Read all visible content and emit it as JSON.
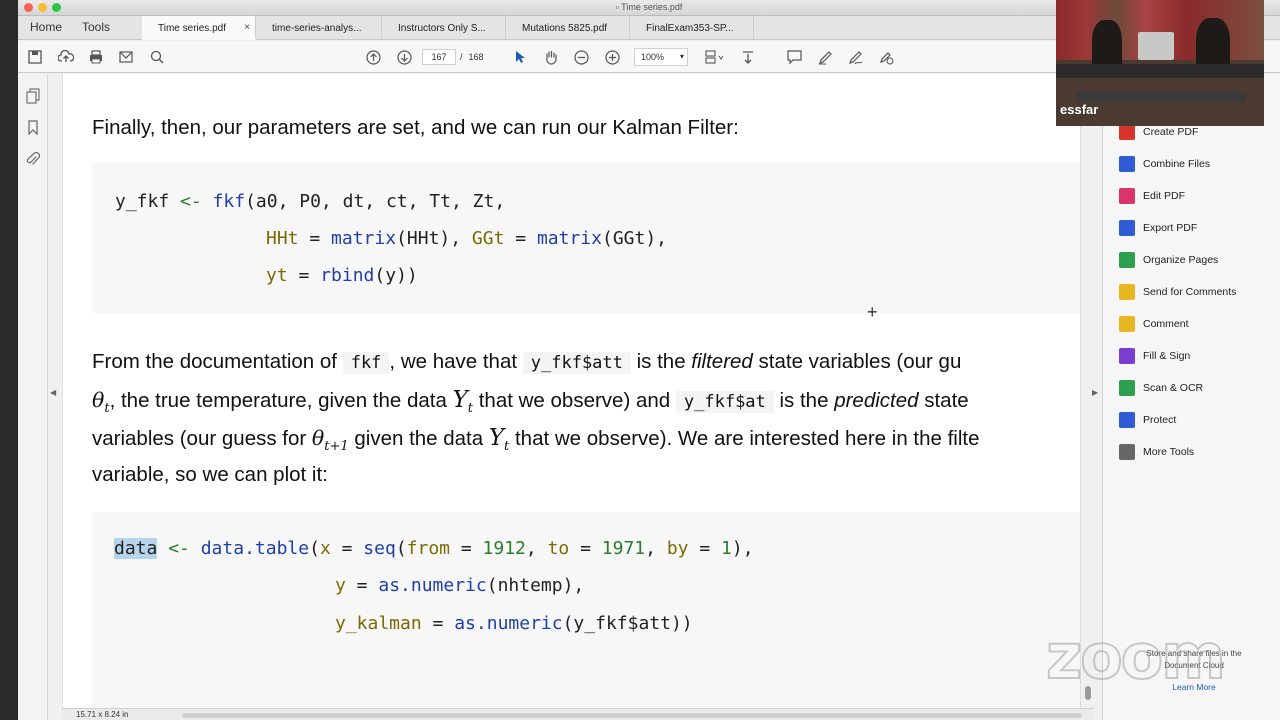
{
  "window": {
    "title": "Time series.pdf"
  },
  "nav": {
    "home": "Home",
    "tools": "Tools"
  },
  "tabs": [
    {
      "label": "Time series.pdf",
      "active": true
    },
    {
      "label": "time-series-analys..."
    },
    {
      "label": "Instructors Only S..."
    },
    {
      "label": "Mutations 5825.pdf"
    },
    {
      "label": "FinalExam353-SP..."
    }
  ],
  "toolbar": {
    "current_page": "167",
    "separator": "/",
    "total_pages": "168",
    "zoom": "100%"
  },
  "doc": {
    "p1": "Finally, then, our parameters are set, and we can run our Kalman Filter:",
    "code1": {
      "l1_var": "y_fkf",
      "l1_op": "<-",
      "l1_fn": "fkf",
      "l1_args": "(a0, P0, dt, ct, Tt, Zt,",
      "l2_a1": "HHt",
      "l2_eq1": " = ",
      "l2_fn1": "matrix",
      "l2_arg1": "(HHt), ",
      "l2_a2": "GGt",
      "l2_eq2": " = ",
      "l2_fn2": "matrix",
      "l2_arg2": "(GGt),",
      "l3_a": "yt",
      "l3_eq": " = ",
      "l3_fn": "rbind",
      "l3_arg": "(y))"
    },
    "p2": {
      "l1_a": "From the documentation of",
      "l1_code1": "fkf",
      "l1_b": ", we have that",
      "l1_code2": "y_fkf$att",
      "l1_c": "is the",
      "l1_em": "filtered",
      "l1_d": "state variables (our gu",
      "l2_math1": "θ",
      "l2_sub1": "t",
      "l2_a": ", the true temperature, given the data",
      "l2_math2": "Y",
      "l2_sub2": "t",
      "l2_b": "that we observe) and",
      "l2_code": "y_fkf$at",
      "l2_c": "is the",
      "l2_em": "predicted",
      "l2_d": "state",
      "l3_a": "variables (our guess for",
      "l3_math1": "θ",
      "l3_sub1": "t+1",
      "l3_b": "given the data",
      "l3_math2": "Y",
      "l3_sub2": "t",
      "l3_c": "that we observe). We are interested here in the filte",
      "l4": "variable, so we can plot it:"
    },
    "code2": {
      "l1_var": "data",
      "l1_op": " <- ",
      "l1_fn": "data.table",
      "l1_p": "(",
      "l1_x": "x",
      "l1_eq": " = ",
      "l1_seq": "seq",
      "l1_p2": "(",
      "l1_from": "from",
      "l1_eq2": " = ",
      "l1_n1": "1912",
      "l1_c1": ", ",
      "l1_to": "to",
      "l1_eq3": " = ",
      "l1_n2": "1971",
      "l1_c2": ", ",
      "l1_by": "by",
      "l1_eq4": " = ",
      "l1_n3": "1",
      "l1_end": "),",
      "l2_y": "y",
      "l2_eq": " = ",
      "l2_fn": "as.numeric",
      "l2_arg": "(nhtemp),",
      "l3_y": "y_kalman",
      "l3_eq": " = ",
      "l3_fn": "as.numeric",
      "l3_arg": "(y_fkf$att))"
    }
  },
  "right_pane": {
    "items": [
      {
        "label": "Create PDF",
        "icon": "create-pdf-icon",
        "color": "#d9342b"
      },
      {
        "label": "Combine Files",
        "icon": "combine-files-icon",
        "color": "#2f5bd3"
      },
      {
        "label": "Edit PDF",
        "icon": "edit-pdf-icon",
        "color": "#d9346b"
      },
      {
        "label": "Export PDF",
        "icon": "export-pdf-icon",
        "color": "#2f5bd3"
      },
      {
        "label": "Organize Pages",
        "icon": "organize-pages-icon",
        "color": "#2e9e4f"
      },
      {
        "label": "Send for Comments",
        "icon": "send-for-comments-icon",
        "color": "#e8b422"
      },
      {
        "label": "Comment",
        "icon": "comment-icon",
        "color": "#e8b422"
      },
      {
        "label": "Fill & Sign",
        "icon": "fill-sign-icon",
        "color": "#7a3fd0"
      },
      {
        "label": "Scan & OCR",
        "icon": "scan-ocr-icon",
        "color": "#2e9e4f"
      },
      {
        "label": "Protect",
        "icon": "protect-icon",
        "color": "#2f5bd3"
      },
      {
        "label": "More Tools",
        "icon": "more-tools-icon",
        "color": "#666666"
      }
    ],
    "cloud_note": "Store and share files in the Document Cloud",
    "learn_more": "Learn More"
  },
  "status": {
    "dims": "15.71 x 8.24 in"
  },
  "webcam": {
    "name": "essfar"
  },
  "watermark": "zoom"
}
